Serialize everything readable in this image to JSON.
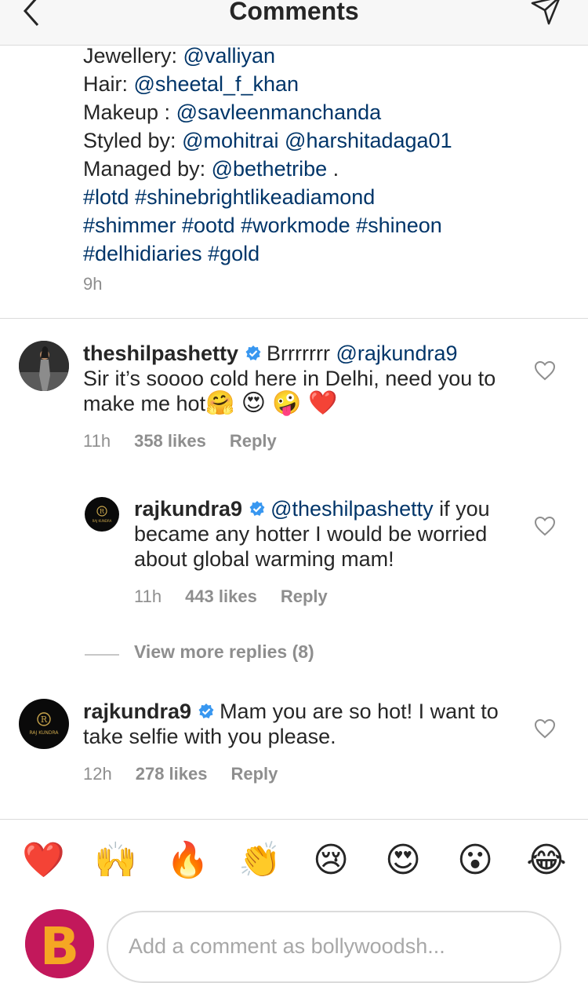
{
  "header": {
    "title": "Comments"
  },
  "caption": {
    "jewellery_label": "Jewellery: ",
    "jewellery_handle": "@valliyan",
    "hair_label": "Hair: ",
    "hair_handle": "@sheetal_f_khan",
    "makeup_label": "Makeup : ",
    "makeup_handle": "@savleenmanchanda",
    "styled_label": "Styled by: ",
    "styled_handle_1": "@mohitrai",
    "styled_handle_2": "@harshitadaga01",
    "managed_label": "Managed by: ",
    "managed_handle": "@bethetribe",
    "managed_suffix": " .",
    "hashtags_line_1": "#lotd #shinebrightlikeadiamond",
    "hashtags_line_2": "#shimmer #ootd #workmode #shineon",
    "hashtags_line_3": "#delhidiaries  #gold",
    "time": "9h"
  },
  "comments": [
    {
      "username": "theshilpashetty",
      "mention": "@rajkundra9",
      "text_before_mention": "Brrrrrrr ",
      "text_after": "Sir it’s soooo cold here in Delhi, need you to make me hot",
      "emojis": "🤗 😍 🤪 ❤️",
      "time": "11h",
      "likes": "358 likes",
      "reply_label": "Reply"
    },
    {
      "username": "rajkundra9",
      "mention": "@theshilpashetty",
      "text_after": " if you became any hotter I would be worried about global warming mam!",
      "time": "11h",
      "likes": "443 likes",
      "reply_label": "Reply",
      "avatar_text": "RAJ KUNDRA"
    },
    {
      "username": "rajkundra9",
      "text": "Mam you are so hot! I want to take selfie with you please.",
      "time": "12h",
      "likes": "278 likes",
      "reply_label": "Reply",
      "avatar_text": "RAJ KUNDRA"
    }
  ],
  "view_more_replies": "View more replies (8)",
  "reactions": [
    "❤️",
    "🙌",
    "🔥",
    "👏",
    "😢",
    "😍",
    "😮",
    "😂"
  ],
  "composer": {
    "placeholder": "Add a comment as bollywoodsh...",
    "avatar_letter": "B"
  },
  "colors": {
    "link": "#003569",
    "muted": "#8e8e8e",
    "verified": "#3897f0",
    "heart_red": "#e0112f"
  }
}
